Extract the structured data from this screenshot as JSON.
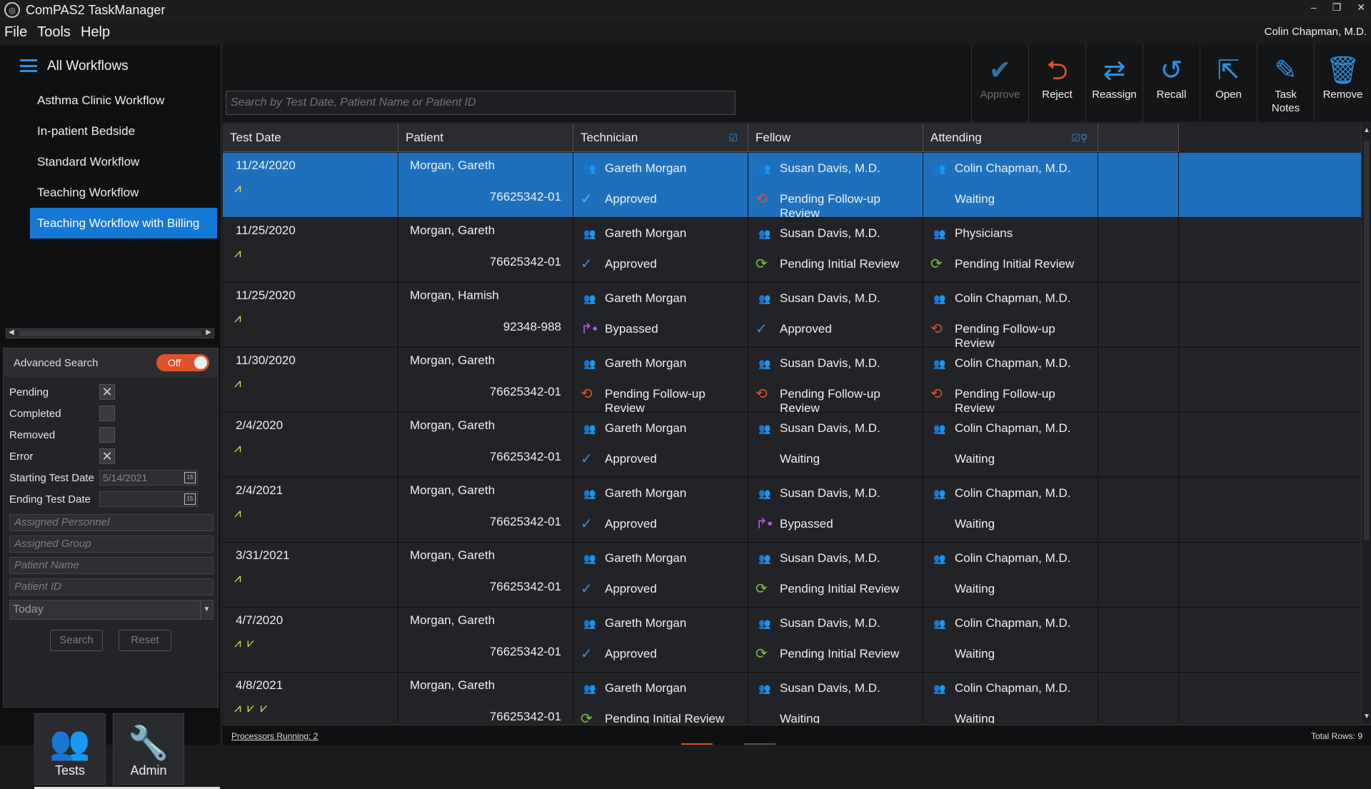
{
  "window": {
    "title": "ComPAS2 TaskManager",
    "controls": [
      "–",
      "❐",
      "✕"
    ]
  },
  "menu": {
    "items": [
      "File",
      "Tools",
      "Help"
    ],
    "user": "Colin Chapman, M.D."
  },
  "workflows": {
    "root": "All Workflows",
    "items": [
      "Asthma Clinic Workflow",
      "In-patient Bedside",
      "Standard Workflow",
      "Teaching Workflow",
      "Teaching Workflow with Billing"
    ],
    "selected_index": 4
  },
  "advanced_search": {
    "title": "Advanced Search",
    "toggle_label": "Off",
    "checks": [
      {
        "label": "Pending",
        "checked": true
      },
      {
        "label": "Completed",
        "checked": false
      },
      {
        "label": "Removed",
        "checked": false
      },
      {
        "label": "Error",
        "checked": true
      }
    ],
    "start_date_label": "Starting Test Date",
    "start_date_value": "5/14/2021",
    "end_date_label": "Ending Test Date",
    "end_date_value": "",
    "placeholders": [
      "Assigned Personnel",
      "Assigned Group",
      "Patient Name",
      "Patient ID"
    ],
    "range_select": "Today",
    "search_label": "Search",
    "reset_label": "Reset"
  },
  "nav": {
    "tests_label": "Tests",
    "admin_label": "Admin"
  },
  "search": {
    "placeholder": "Search by Test Date, Patient Name or Patient ID"
  },
  "toolbar": [
    {
      "id": "approve",
      "icon": "✔",
      "label": "Approve",
      "label2": "",
      "disabled": true
    },
    {
      "id": "reject",
      "icon": "⮌",
      "label": "Reject",
      "label2": "",
      "disabled": false
    },
    {
      "id": "reassign",
      "icon": "⇄",
      "label": "Reassign",
      "label2": "",
      "disabled": false
    },
    {
      "id": "recall",
      "icon": "↺",
      "label": "Recall",
      "label2": "",
      "disabled": false
    },
    {
      "id": "open",
      "icon": "⇱",
      "label": "Open",
      "label2": "",
      "disabled": false
    },
    {
      "id": "task-notes",
      "icon": "✎",
      "label": "Task",
      "label2": "Notes",
      "disabled": false
    },
    {
      "id": "remove",
      "icon": "🗑",
      "label": "Remove",
      "label2": "",
      "disabled": false
    }
  ],
  "columns": [
    "Test Date",
    "Patient",
    "Technician",
    "Fellow",
    "Attending"
  ],
  "rows": [
    {
      "date": "11/24/2020",
      "waves": "⩘",
      "patient": "Morgan, Gareth",
      "pid": "76625342-01",
      "tech": "Gareth Morgan",
      "tech_status": "Approved",
      "tech_s": "approved",
      "fellow": "Susan Davis, M.D.",
      "fellow_status": "Pending Follow-up Review",
      "fellow_s": "followup",
      "att": "Colin Chapman, M.D.",
      "att_status": "Waiting",
      "att_s": "none",
      "selected": true
    },
    {
      "date": "11/25/2020",
      "waves": "⩘",
      "patient": "Morgan, Gareth",
      "pid": "76625342-01",
      "tech": "Gareth Morgan",
      "tech_status": "Approved",
      "tech_s": "approved",
      "fellow": "Susan Davis, M.D.",
      "fellow_status": "Pending Initial Review",
      "fellow_s": "initial",
      "att": "Physicians",
      "att_status": "Pending Initial Review",
      "att_s": "initial",
      "selected": false
    },
    {
      "date": "11/25/2020",
      "waves": "⩘",
      "patient": "Morgan, Hamish",
      "pid": "92348-988",
      "tech": "Gareth Morgan",
      "tech_status": "Bypassed",
      "tech_s": "bypassed",
      "fellow": "Susan Davis, M.D.",
      "fellow_status": "Approved",
      "fellow_s": "approved",
      "att": "Colin Chapman, M.D.",
      "att_status": "Pending Follow-up Review",
      "att_s": "followup",
      "selected": false
    },
    {
      "date": "11/30/2020",
      "waves": "⩘",
      "patient": "Morgan, Gareth",
      "pid": "76625342-01",
      "tech": "Gareth Morgan",
      "tech_status": "Pending Follow-up Review",
      "tech_s": "followup",
      "fellow": "Susan Davis, M.D.",
      "fellow_status": "Pending Follow-up Review",
      "fellow_s": "followup",
      "att": "Colin Chapman, M.D.",
      "att_status": "Pending Follow-up Review",
      "att_s": "followup",
      "selected": false
    },
    {
      "date": "2/4/2020",
      "waves": "⩘",
      "patient": "Morgan, Gareth",
      "pid": "76625342-01",
      "tech": "Gareth Morgan",
      "tech_status": "Approved",
      "tech_s": "approved",
      "fellow": "Susan Davis, M.D.",
      "fellow_status": "Waiting",
      "fellow_s": "none",
      "att": "Colin Chapman, M.D.",
      "att_status": "Waiting",
      "att_s": "none",
      "selected": false
    },
    {
      "date": "2/4/2021",
      "waves": "⩘",
      "patient": "Morgan, Gareth",
      "pid": "76625342-01",
      "tech": "Gareth Morgan",
      "tech_status": "Approved",
      "tech_s": "approved",
      "fellow": "Susan Davis, M.D.",
      "fellow_status": "Bypassed",
      "fellow_s": "bypassed",
      "att": "Colin Chapman, M.D.",
      "att_status": "Waiting",
      "att_s": "none",
      "selected": false
    },
    {
      "date": "3/31/2021",
      "waves": "⩘",
      "patient": "Morgan, Gareth",
      "pid": "76625342-01",
      "tech": "Gareth Morgan",
      "tech_status": "Approved",
      "tech_s": "approved",
      "fellow": "Susan Davis, M.D.",
      "fellow_status": "Pending Initial Review",
      "fellow_s": "initial",
      "att": "Colin Chapman, M.D.",
      "att_status": "Waiting",
      "att_s": "none",
      "selected": false
    },
    {
      "date": "4/7/2020",
      "waves": "⩘ ⩗",
      "patient": "Morgan, Gareth",
      "pid": "76625342-01",
      "tech": "Gareth Morgan",
      "tech_status": "Approved",
      "tech_s": "approved",
      "fellow": "Susan Davis, M.D.",
      "fellow_status": "Pending Initial Review",
      "fellow_s": "initial",
      "att": "Colin Chapman, M.D.",
      "att_status": "Waiting",
      "att_s": "none",
      "selected": false
    },
    {
      "date": "4/8/2021",
      "waves": "⩘ ⩗ ⩗",
      "patient": "Morgan, Gareth",
      "pid": "76625342-01",
      "tech": "Gareth Morgan",
      "tech_status": "Pending Initial Review",
      "tech_s": "initial",
      "fellow": "Susan Davis, M.D.",
      "fellow_status": "Waiting",
      "fellow_s": "none",
      "att": "Colin Chapman, M.D.",
      "att_status": "Waiting",
      "att_s": "none",
      "selected": false
    }
  ],
  "statusbar": {
    "processors": "Processors Running:  2",
    "total": "Total Rows:  9"
  },
  "colors": {
    "accent": "#1478d6",
    "followup": "#e0512a",
    "initial": "#7fbf3f",
    "bypassed": "#b35ce0"
  }
}
